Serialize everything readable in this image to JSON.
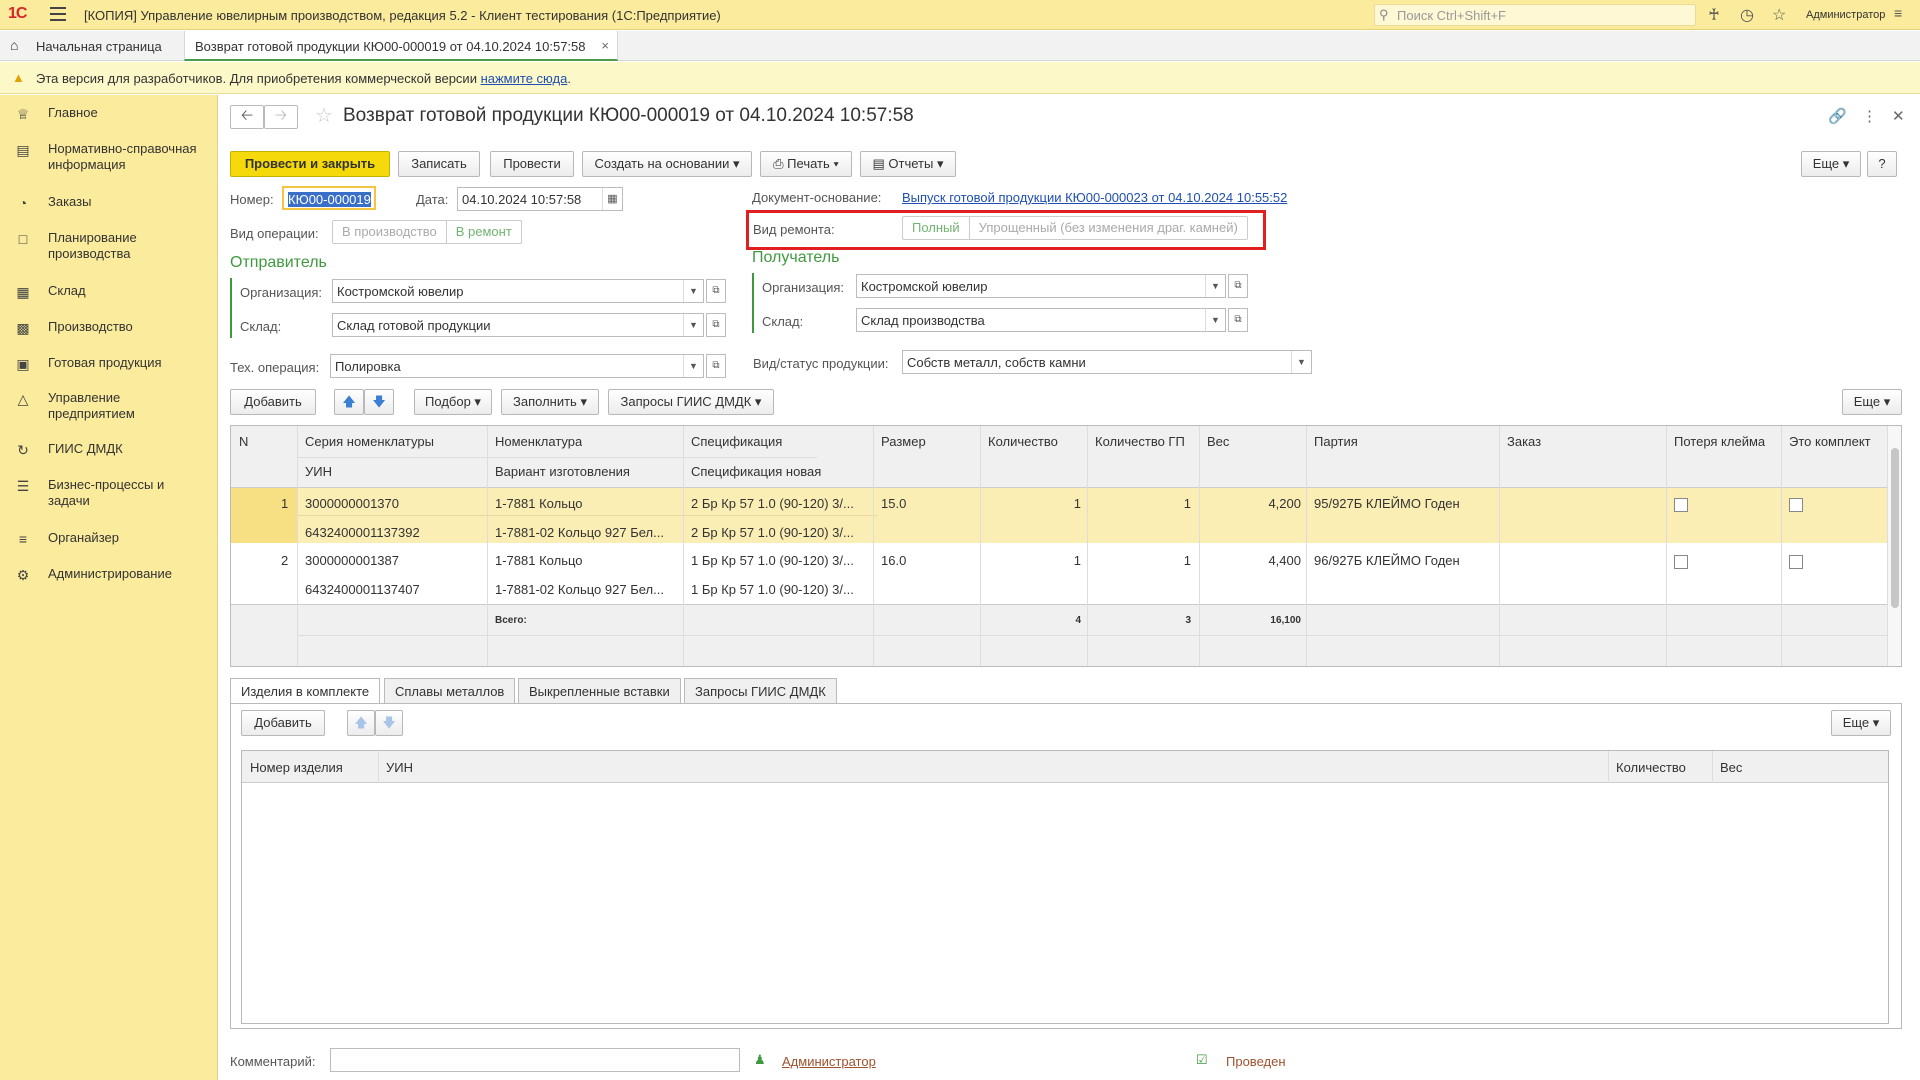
{
  "app": {
    "title": "[КОПИЯ] Управление ювелирным производством, редакция 5.2  - Клиент тестирования (1С:Предприятие)",
    "logo": "1С",
    "search_placeholder": "Поиск Ctrl+Shift+F",
    "user": "Администратор"
  },
  "tabs": {
    "home": "Начальная страница",
    "doc": "Возврат готовой продукции КЮ00-000019 от 04.10.2024 10:57:58"
  },
  "warning": {
    "text": "Эта версия для разработчиков. Для приобретения коммерческой версии ",
    "link": "нажмите сюда",
    "end": "."
  },
  "sidebar": {
    "items": [
      {
        "label": "Главное",
        "icon": "crown-icon"
      },
      {
        "label": "Нормативно-справочная информация",
        "icon": "book-icon"
      },
      {
        "label": "Заказы",
        "icon": "pie-icon"
      },
      {
        "label": "Планирование производства",
        "icon": "clipboard-icon"
      },
      {
        "label": "Склад",
        "icon": "grid-icon"
      },
      {
        "label": "Производство",
        "icon": "factory-icon"
      },
      {
        "label": "Готовая продукция",
        "icon": "bag-icon"
      },
      {
        "label": "Управление предприятием",
        "icon": "chart-icon"
      },
      {
        "label": "ГИИС ДМДК",
        "icon": "sync-icon"
      },
      {
        "label": "Бизнес-процессы и задачи",
        "icon": "list-icon"
      },
      {
        "label": "Органайзер",
        "icon": "organizer-icon"
      },
      {
        "label": "Администрирование",
        "icon": "gear-icon"
      }
    ]
  },
  "doc": {
    "title": "Возврат готовой продукции КЮ00-000019 от 04.10.2024 10:57:58",
    "toolbar": {
      "post_close": "Провести и закрыть",
      "save": "Записать",
      "post": "Провести",
      "create_based": "Создать на основании",
      "print": "Печать",
      "reports": "Отчеты",
      "more": "Еще",
      "help": "?"
    },
    "number_label": "Номер:",
    "number": "КЮ00-000019",
    "date_label": "Дата:",
    "date": "04.10.2024 10:57:58",
    "op_label": "Вид операции:",
    "op_options": [
      "В производство",
      "В ремонт"
    ],
    "basis_label": "Документ-основание:",
    "basis": "Выпуск готовой продукции КЮ00-000023 от 04.10.2024 10:55:52",
    "repair_label": "Вид ремонта:",
    "repair_options": [
      "Полный",
      "Упрощенный (без изменения драг. камней)"
    ],
    "sender": {
      "title": "Отправитель",
      "org_label": "Организация:",
      "org": "Костромской ювелир",
      "wh_label": "Склад:",
      "wh": "Склад готовой продукции"
    },
    "receiver": {
      "title": "Получатель",
      "org_label": "Организация:",
      "org": "Костромской ювелир",
      "wh_label": "Склад:",
      "wh": "Склад производства"
    },
    "tech_label": "Тех. операция:",
    "tech": "Полировка",
    "status_label": "Вид/статус продукции:",
    "status": "Собств металл, собств камни",
    "table_toolbar": {
      "add": "Добавить",
      "pick": "Подбор",
      "fill": "Заполнить",
      "giis": "Запросы ГИИС ДМДК",
      "more": "Еще"
    },
    "columns": {
      "n": "N",
      "series": "Серия номенклатуры",
      "uin": "УИН",
      "nom": "Номенклатура",
      "variant": "Вариант изготовления",
      "spec": "Спецификация",
      "spec_new": "Спецификация новая",
      "size": "Размер",
      "qty": "Количество",
      "qty_gp": "Количество ГП",
      "weight": "Вес",
      "batch": "Партия",
      "order": "Заказ",
      "loss": "Потеря клейма",
      "kit": "Это комплект"
    },
    "rows": [
      {
        "n": "1",
        "series": "3000000001370",
        "uin": "6432400001137392",
        "nom": "1-7881 Кольцо",
        "variant": "1-7881-02 Кольцо 927 Бел...",
        "spec": "2 Бр Кр 57 1.0 (90-120) 3/...",
        "spec_new": "2 Бр Кр 57 1.0 (90-120) 3/...",
        "size": "15.0",
        "qty": "1",
        "qty_gp": "1",
        "weight": "4,200",
        "batch": "95/927Б КЛЕЙМО Годен"
      },
      {
        "n": "2",
        "series": "3000000001387",
        "uin": "6432400001137407",
        "nom": "1-7881 Кольцо",
        "variant": "1-7881-02 Кольцо 927 Бел...",
        "spec": "1 Бр Кр 57 1.0 (90-120) 3/...",
        "spec_new": "1 Бр Кр 57 1.0 (90-120) 3/...",
        "size": "16.0",
        "qty": "1",
        "qty_gp": "1",
        "weight": "4,400",
        "batch": "96/927Б КЛЕЙМО Годен"
      }
    ],
    "totals": {
      "label": "Всего:",
      "qty": "4",
      "qty_gp": "3",
      "weight": "16,100"
    },
    "bottom_tabs": [
      "Изделия в комплекте",
      "Сплавы металлов",
      "Выкрепленные вставки",
      "Запросы ГИИС ДМДК"
    ],
    "sub": {
      "add": "Добавить",
      "more": "Еще",
      "columns": [
        "Номер изделия",
        "УИН",
        "Количество",
        "Вес"
      ]
    },
    "comment_label": "Комментарий:",
    "comment": "",
    "author": "Администратор",
    "state": "Проведен"
  },
  "colors": {
    "accent": "#f5d90a",
    "sidebar": "#fbeb9c",
    "section": "#3f9a3f",
    "selected_row": "#fbeeb4",
    "highlight": "#e02020"
  }
}
